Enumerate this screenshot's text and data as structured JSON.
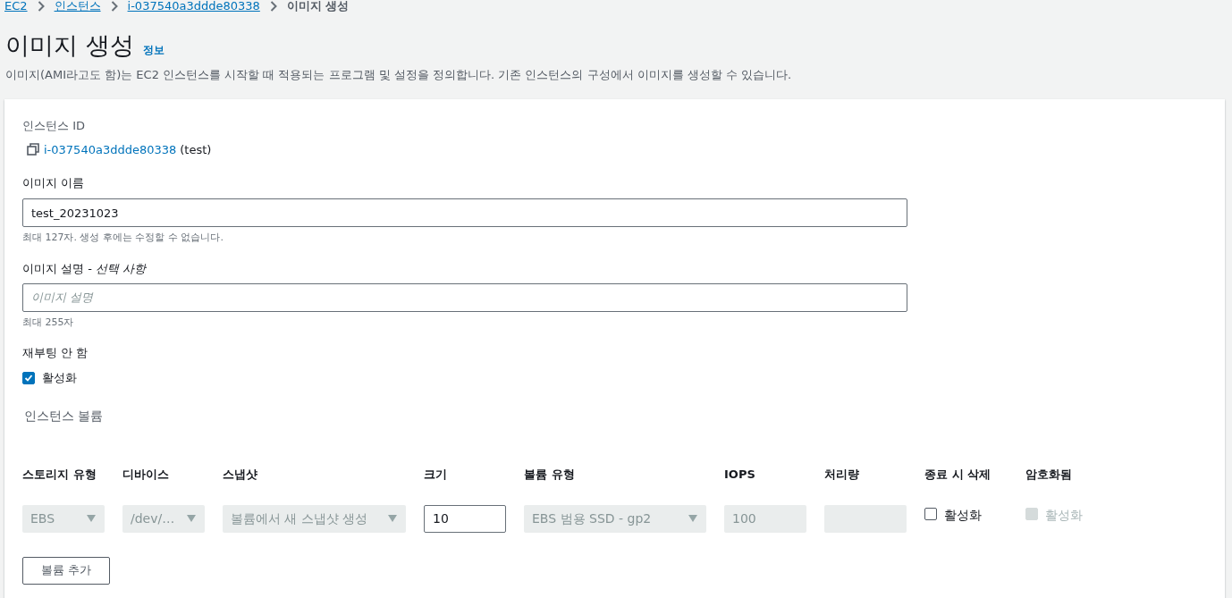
{
  "breadcrumb": [
    {
      "label": "EC2",
      "kind": "link"
    },
    {
      "label": "인스턴스",
      "kind": "link"
    },
    {
      "label": "i-037540a3ddde80338",
      "kind": "link"
    },
    {
      "label": "이미지 생성",
      "kind": "current"
    }
  ],
  "title": "이미지 생성",
  "info_link": "정보",
  "description": "이미지(AMI라고도 함)는 EC2 인스턴스를 시작할 때 적용되는 프로그램 및 설정을 정의합니다. 기존 인스턴스의 구성에서 이미지를 생성할 수 있습니다.",
  "instance_id": {
    "label": "인스턴스 ID",
    "value": "i-037540a3ddde80338",
    "suffix": "(test)"
  },
  "image_name": {
    "label": "이미지 이름",
    "value": "test_20231023",
    "hint": "최대 127자. 생성 후에는 수정할 수 없습니다."
  },
  "image_description": {
    "label": "이미지 설명 - *선택 사항*",
    "placeholder": "이미지 설명",
    "hint": "최대 255자"
  },
  "no_reboot": {
    "label": "재부팅 안 함",
    "option": "활성화",
    "checked": true
  },
  "volumes": {
    "title": "인스턴스 볼륨",
    "columns": [
      "스토리지 유형",
      "디바이스",
      "스냅샷",
      "크기",
      "볼륨 유형",
      "IOPS",
      "처리량",
      "종료 시 삭제",
      "암호화됨"
    ],
    "rows": [
      [
        {
          "kind": "select",
          "value": "EBS",
          "disabled": true
        },
        {
          "kind": "select",
          "value": "/dev/…",
          "disabled": true
        },
        {
          "kind": "select",
          "value": "볼륨에서 새 스냅샷 생성",
          "disabled": true
        },
        {
          "kind": "input",
          "value": "10",
          "disabled": false
        },
        {
          "kind": "select",
          "value": "EBS 범용 SSD - gp2",
          "disabled": true
        },
        {
          "kind": "input",
          "value": "100",
          "disabled": true
        },
        {
          "kind": "input",
          "disabled": true
        },
        {
          "kind": "checkbox",
          "label": "활성화",
          "checked": false,
          "disabled": false
        },
        {
          "kind": "checkbox",
          "label": "활성화",
          "checked": false,
          "disabled": true
        }
      ]
    ]
  },
  "add_button": "볼륨 추가"
}
